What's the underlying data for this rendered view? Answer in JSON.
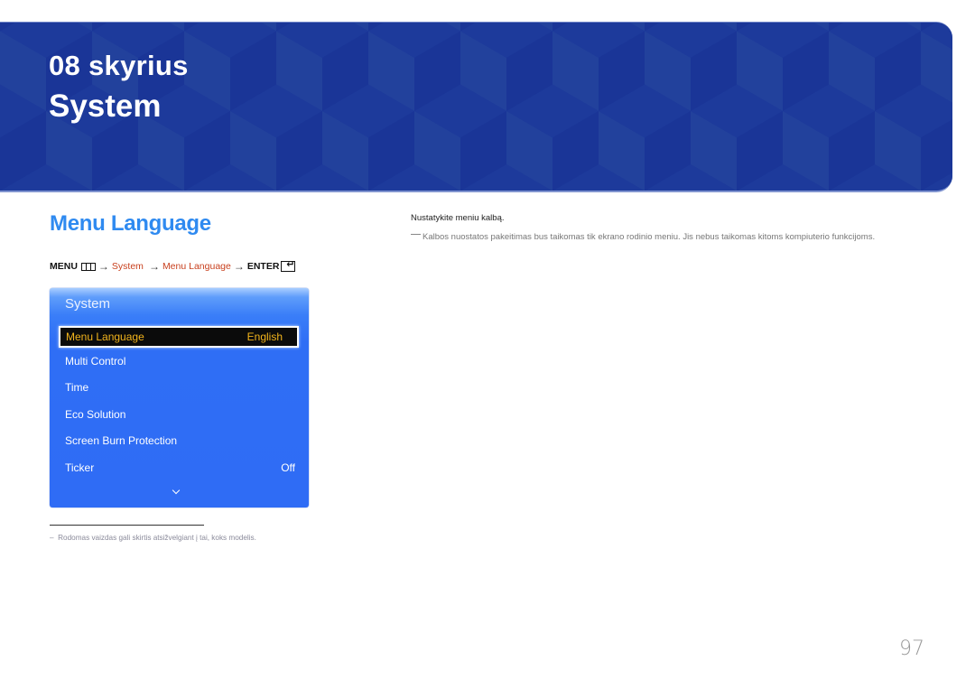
{
  "banner": {
    "chapter_number": "08 skyrius",
    "chapter_title": "System",
    "colors": {
      "base": "#1d3a9b",
      "light_face": "#22419c",
      "dark_face": "#1a3597"
    }
  },
  "section": {
    "title": "Menu Language",
    "title_color": "#2f8af0"
  },
  "path": {
    "menu_label": "MENU",
    "menu_icon": "menu-icon",
    "arrow": "→",
    "step1": "System",
    "step2": "Menu Language",
    "enter_label": "ENTER",
    "enter_icon": "enter-icon",
    "highlight_color": "#c8401e"
  },
  "osd": {
    "title": "System",
    "items": [
      {
        "label": "Menu Language",
        "value": "English",
        "selected": true
      },
      {
        "label": "Multi Control",
        "value": ""
      },
      {
        "label": "Time",
        "value": ""
      },
      {
        "label": "Eco Solution",
        "value": ""
      },
      {
        "label": "Screen Burn Protection",
        "value": ""
      },
      {
        "label": "Ticker",
        "value": "Off"
      }
    ],
    "more_icon": "chevron-down-icon",
    "selected_text_color": "#f2b41c"
  },
  "description": {
    "text": "Nustatykite meniu kalbą.",
    "note": "Kalbos nuostatos pakeitimas bus taikomas tik ekrano rodinio meniu. Jis nebus taikomas kitoms kompiuterio funkcijoms."
  },
  "footnote": {
    "marker": "–",
    "text": "Rodomas vaizdas gali skirtis atsižvelgiant į tai, koks modelis."
  },
  "page_number": "97"
}
